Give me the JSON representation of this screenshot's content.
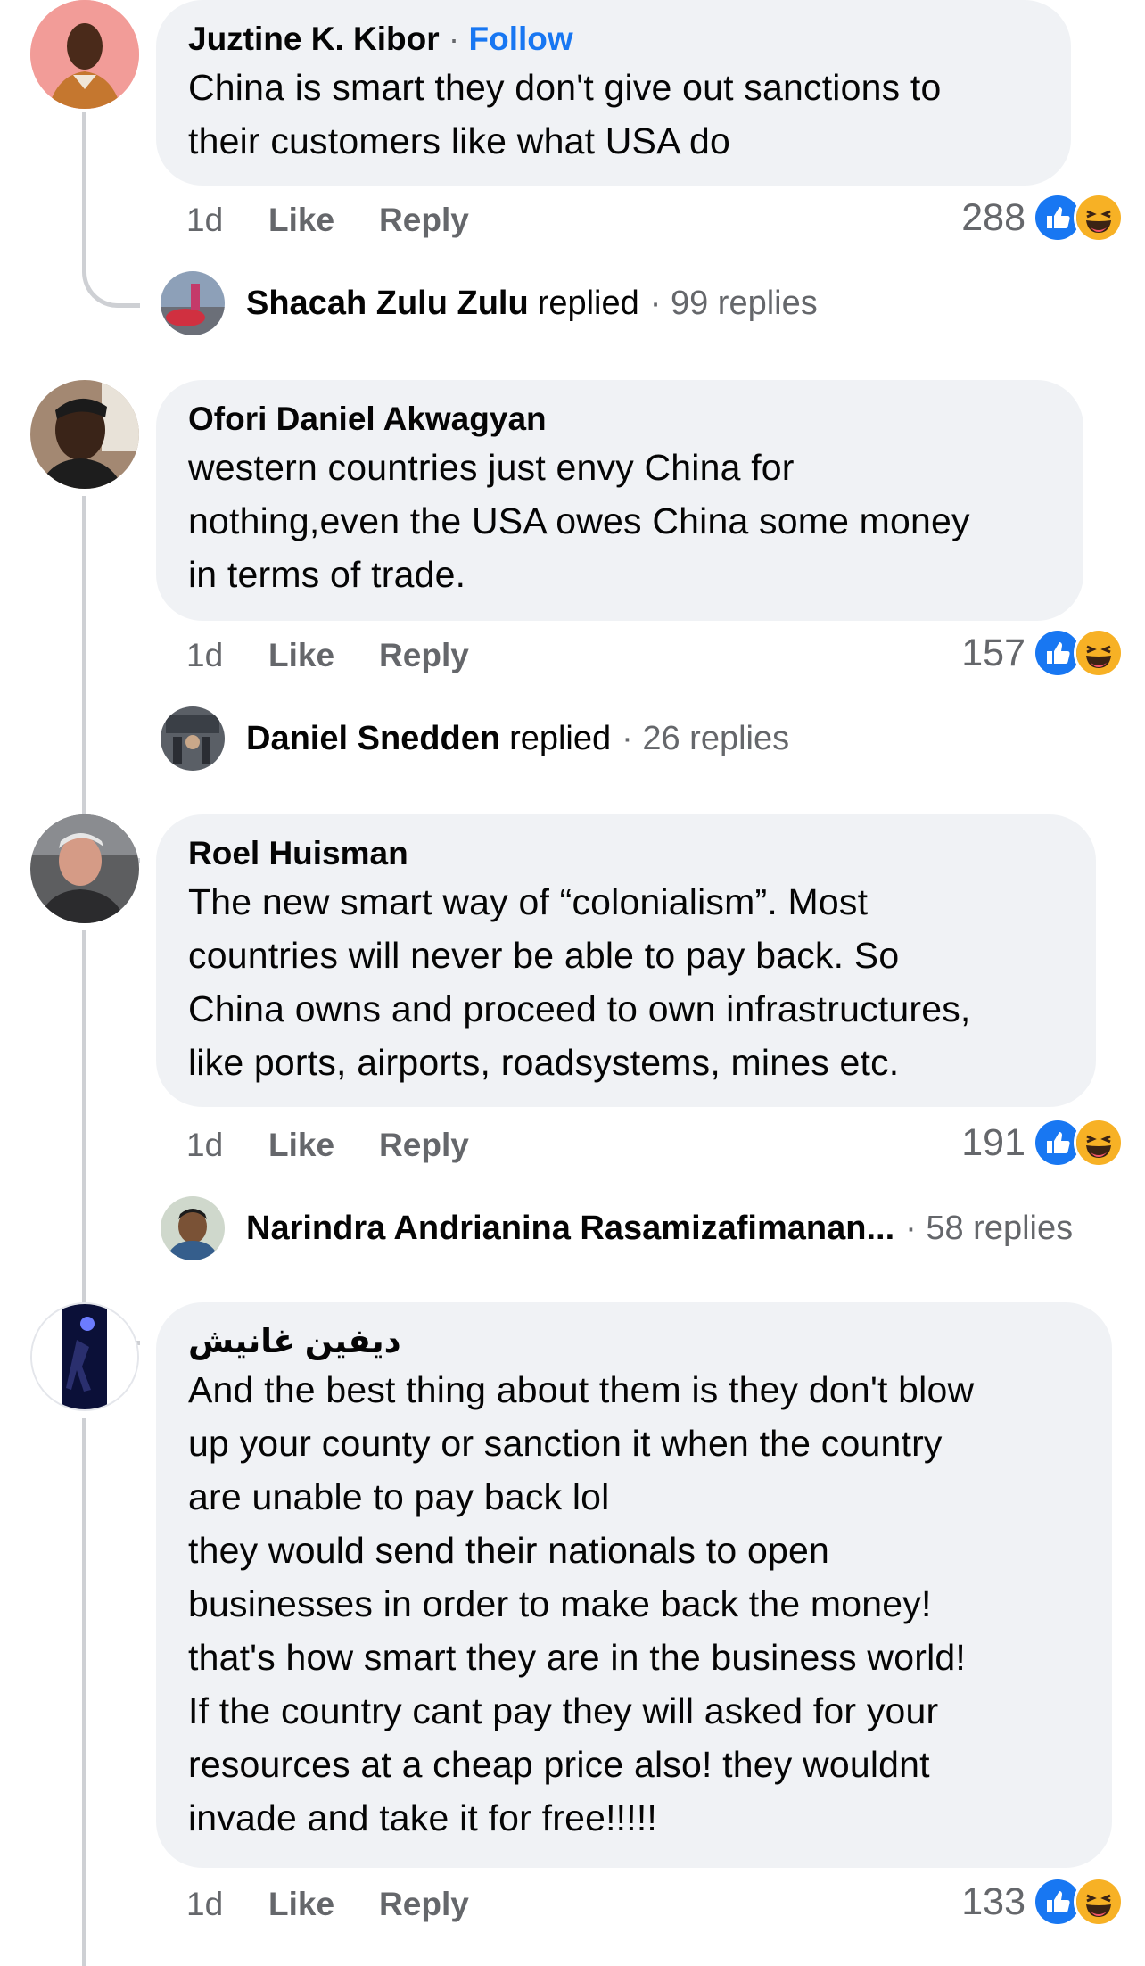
{
  "comments": [
    {
      "author": "Juztine K. Kibor",
      "follow": "Follow",
      "separator": "·",
      "text": "China is smart they don't give out sanctions to\ntheir customers like what USA do",
      "age": "1d",
      "like": "Like",
      "reply": "Reply",
      "reactions": "288",
      "replier": "Shacah Zulu Zulu",
      "replied": "replied",
      "replies": "· 99 replies"
    },
    {
      "author": "Ofori Daniel Akwagyan",
      "text": "western countries just envy China for\nnothing,even the USA owes China some money\nin terms of trade.",
      "age": "1d",
      "like": "Like",
      "reply": "Reply",
      "reactions": "157",
      "replier": "Daniel Snedden",
      "replied": "replied",
      "replies": "· 26 replies"
    },
    {
      "author": "Roel Huisman",
      "text": "The new smart way of “colonialism”. Most\ncountries will never be able to pay back. So\nChina owns and proceed to own infrastructures,\nlike ports, airports, roadsystems, mines etc.",
      "age": "1d",
      "like": "Like",
      "reply": "Reply",
      "reactions": "191",
      "replier": "Narindra Andrianina Rasamizafimanan...",
      "replies": "· 58 replies"
    },
    {
      "author": "ديفين غانيش",
      "text": "And the best thing about them is they don't blow\nup your county or sanction it when the country\nare unable to pay back lol\nthey would send their nationals to open\nbusinesses in order to make back the money!\nthat's how smart they  are in the business world!\nIf the country cant pay they will asked for your\nresources at a cheap price also! they wouldnt\ninvade and take it for free!!!!!",
      "age": "1d",
      "like": "Like",
      "reply": "Reply",
      "reactions": "133"
    }
  ],
  "colors": {
    "bubble": "#f0f2f5",
    "link": "#1877f2",
    "secondary_text": "#65676b",
    "thread_line": "#ced0d4",
    "like_blue": "#1877f2",
    "haha_yellow": "#f7b125"
  }
}
